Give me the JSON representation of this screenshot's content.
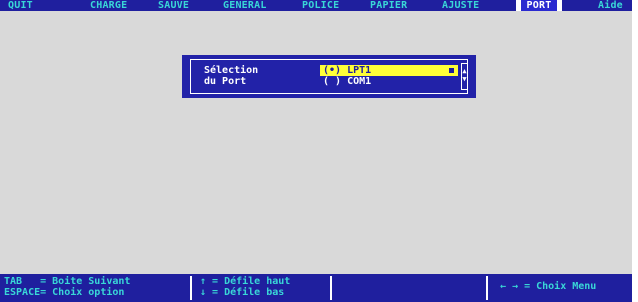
{
  "menu": {
    "items": [
      "QUIT",
      "CHARGE",
      "SAUVE",
      "GENERAL",
      "POLICE",
      "PAPIER",
      "AJUSTE",
      "PORT",
      "Aide"
    ],
    "active": "PORT"
  },
  "dialog": {
    "label_line1": "Sélection",
    "label_line2": "du Port",
    "options": [
      {
        "text": "(•) LPT1",
        "selected": true
      },
      {
        "text": "( ) COM1",
        "selected": false
      }
    ],
    "scroll_up_icon": "arrow-up-icon",
    "scroll_down_icon": "arrow-down-icon"
  },
  "statusbar": {
    "tab_line": "TAB   = Boite Suivant",
    "space_line": "ESPACE= Choix option",
    "up_line": "↑ = Défile haut",
    "down_line": "↓ = Défile bas",
    "menu_hint": "← → = Choix Menu"
  },
  "colors": {
    "background": "#d9d9d9",
    "bar": "#1f1f9e",
    "menu_text": "#39d7d7",
    "highlight": "#ffff38"
  }
}
